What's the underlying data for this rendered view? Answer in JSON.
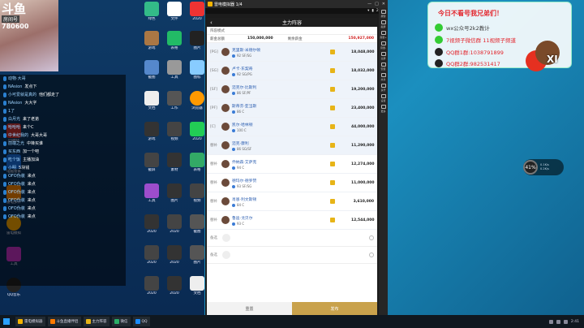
{
  "stream": {
    "logo": "斗鱼",
    "room_label": "房间号",
    "room_number": "780600"
  },
  "banner": {
    "title": "今日不看号我兄弟们！",
    "wechat": "wx公众号2k2教计",
    "group1": "7视频子微信群 11视频子频道",
    "qq1": "QQ群1群:1038791899",
    "qq2": "QQ群2群:982531417",
    "mascot_label": "XI"
  },
  "emulator": {
    "window_title": "雷电模拟器 1/4",
    "status_time": "2:41",
    "side_tools": [
      "按键",
      "截屏",
      "音量+",
      "音量-",
      "全屏",
      "安装",
      "共享",
      "多开",
      "设置",
      "更多"
    ]
  },
  "game": {
    "header": "主力阵容",
    "formation_label": "阵容模式",
    "formation_value": "",
    "salary_label": "薪金总额",
    "salary_value": "150,000,000",
    "remaining_label": "剩余薪金",
    "total_value": "150,927,000",
    "players": [
      {
        "pos": "[PG]",
        "name": "克里斯·米德尔顿",
        "ovr": "92",
        "role": "SF/SG",
        "salary": "18,048,000",
        "starter": true
      },
      {
        "pos": "[SG]",
        "name": "卢卡·东契奇",
        "ovr": "92",
        "role": "SG/PG",
        "salary": "18,032,000",
        "starter": true
      },
      {
        "pos": "[SF]",
        "name": "迈克尔·比斯利",
        "ovr": "86",
        "role": "SF/PF",
        "salary": "19,200,000",
        "starter": true
      },
      {
        "pos": "[PF]",
        "name": "斯蒂芬·亚当斯",
        "ovr": "86",
        "role": "C",
        "salary": "23,400,000",
        "starter": true
      },
      {
        "pos": "[C]",
        "name": "凯尔·哈林顿",
        "ovr": "100",
        "role": "C",
        "salary": "44,000,000",
        "starter": true
      },
      {
        "pos": "替补",
        "name": "迈克·康利",
        "ovr": "86",
        "role": "SG/SF",
        "salary": "11,290,000",
        "starter": true
      },
      {
        "pos": "替补",
        "name": "乔纳森·艾萨克",
        "ovr": "94",
        "role": "C",
        "salary": "12,274,000",
        "starter": false
      },
      {
        "pos": "替补",
        "name": "德玛尔·德罗赞",
        "ovr": "93",
        "role": "SF/SG",
        "salary": "11,000,000",
        "starter": false
      },
      {
        "pos": "替补",
        "name": "肖恩·利文斯顿",
        "ovr": "84",
        "role": "C",
        "salary": "3,610,000",
        "starter": false
      },
      {
        "pos": "替补",
        "name": "鲁迪·戈贝尔",
        "ovr": "93",
        "role": "C",
        "salary": "12,544,000",
        "starter": false
      }
    ],
    "empty_label_1": "备选",
    "empty_label_2": "备选",
    "reset_label": "重置",
    "publish_label": "发布"
  },
  "network": {
    "percent": "41%",
    "up": "0.1K/s",
    "down": "0.2K/s"
  },
  "chat": [
    {
      "user": "动物·大哥",
      "msg": ""
    },
    {
      "user": "NAsion",
      "msg": "发点下"
    },
    {
      "user": "小可爱就是真的",
      "msg": "他们都走了"
    },
    {
      "user": "NAsion",
      "msg": "大大字"
    },
    {
      "user": "1了",
      "msg": ""
    },
    {
      "user": "白月光",
      "msg": "来了老弟"
    },
    {
      "user": "哈哈哈",
      "msg": "来个C"
    },
    {
      "user": "中世纪我的",
      "msg": "大哥大哥"
    },
    {
      "user": "前端之光",
      "msg": "中锋买谁"
    },
    {
      "user": "买东西",
      "msg": "加一个吧"
    },
    {
      "user": "吃个饭",
      "msg": "主播加油"
    },
    {
      "user": "小明",
      "msg": "5块钱"
    },
    {
      "user": "OFO伪装",
      "msg": "来点"
    },
    {
      "user": "OFO伪装",
      "msg": "来点"
    },
    {
      "user": "OFO伪装",
      "msg": "来点"
    },
    {
      "user": "OFO伪装",
      "msg": "来点"
    },
    {
      "user": "OFO伪装",
      "msg": "来点"
    },
    {
      "user": "OFO伪装",
      "msg": "来点"
    }
  ],
  "taskbar": {
    "tasks": [
      "雷电模拟器",
      "斗鱼直播伴侣",
      "主力阵容",
      "微信",
      "QQ"
    ],
    "time": "2:41"
  }
}
